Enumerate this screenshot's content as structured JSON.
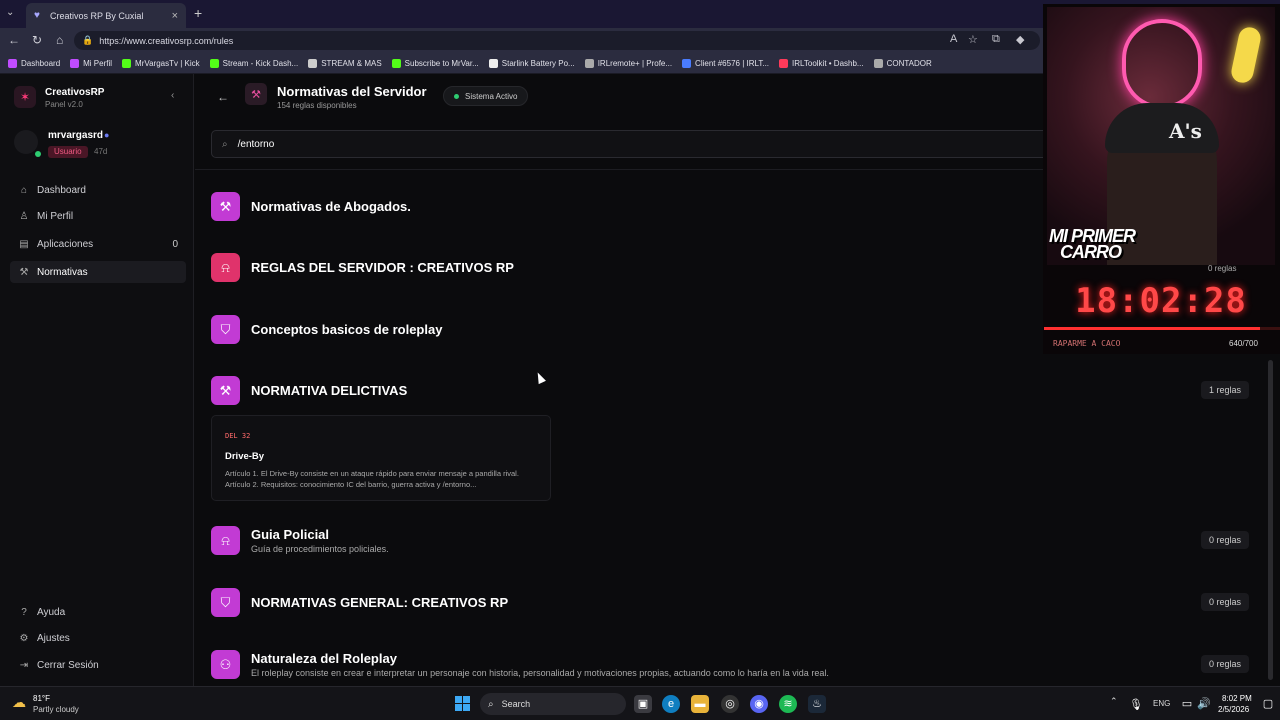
{
  "browser": {
    "tab_title": "Creativos RP By Cuxial",
    "url": "https://www.creativosrp.com/rules",
    "bookmarks": [
      {
        "label": "Dashboard",
        "color": "#c04cff"
      },
      {
        "label": "Mi Perfil",
        "color": "#c04cff"
      },
      {
        "label": "MrVargasTv | Kick",
        "color": "#53fc18"
      },
      {
        "label": "Stream - Kick Dash...",
        "color": "#53fc18"
      },
      {
        "label": "STREAM & MAS",
        "color": "#cccccc"
      },
      {
        "label": "Subscribe to MrVar...",
        "color": "#53fc18"
      },
      {
        "label": "Starlink Battery Po...",
        "color": "#eeeeee"
      },
      {
        "label": "IRLremote+ | Profe...",
        "color": "#aaaaaa"
      },
      {
        "label": "Client #6576 | IRLT...",
        "color": "#4a7cff"
      },
      {
        "label": "IRLToolkit • Dashb...",
        "color": "#ff3a5a"
      },
      {
        "label": "CONTADOR",
        "color": "#aaaaaa"
      }
    ]
  },
  "sidebar": {
    "brand_name": "CreativosRP",
    "brand_sub": "Panel v2.0",
    "username": "mrvargasrd",
    "role": "Usuario",
    "age": "47d",
    "items": [
      {
        "label": "Dashboard",
        "icon": "home-icon",
        "count": ""
      },
      {
        "label": "Mi Perfil",
        "icon": "user-icon",
        "count": ""
      },
      {
        "label": "Aplicaciones",
        "icon": "document-icon",
        "count": "0"
      },
      {
        "label": "Normativas",
        "icon": "gavel-icon",
        "count": ""
      }
    ],
    "bottom_items": [
      {
        "label": "Ayuda",
        "icon": "help-icon"
      },
      {
        "label": "Ajustes",
        "icon": "gear-icon"
      },
      {
        "label": "Cerrar Sesión",
        "icon": "logout-icon"
      }
    ]
  },
  "header": {
    "title": "Normativas del Servidor",
    "subtitle": "154 reglas disponibles",
    "status": "Sistema Activo"
  },
  "search": {
    "value": "/entorno"
  },
  "categories": [
    {
      "title": "Normativas de Abogados.",
      "desc": "",
      "count": "",
      "icon": "gavel-icon",
      "color": "#c23bd4"
    },
    {
      "title": "REGLAS DEL SERVIDOR : CREATIVOS RP",
      "desc": "",
      "count": "",
      "icon": "siren-icon",
      "color": "#e0336b"
    },
    {
      "title": "Conceptos basicos de roleplay",
      "desc": "",
      "count": "",
      "icon": "shield-icon",
      "color": "#c23bd4"
    },
    {
      "title": "NORMATIVA DELICTIVAS",
      "desc": "",
      "count": "1 reglas",
      "icon": "gavel-icon",
      "color": "#c23bd4"
    },
    {
      "title": "Guia Policial",
      "desc": "Guía de procedimientos policiales.",
      "count": "0 reglas",
      "icon": "siren-icon",
      "color": "#c23bd4"
    },
    {
      "title": "NORMATIVAS GENERAL: CREATIVOS RP",
      "desc": "",
      "count": "0 reglas",
      "icon": "shield-icon",
      "color": "#c23bd4"
    },
    {
      "title": "Naturaleza del Roleplay",
      "desc": "El roleplay consiste en crear e interpretar un personaje con historia, personalidad y motivaciones propias, actuando como lo haría en la vida real.",
      "count": "0 reglas",
      "icon": "users-icon",
      "color": "#c23bd4"
    }
  ],
  "rule": {
    "code": "DEL 32",
    "name": "Drive-By",
    "text": "Artículo 1. El Drive-By consiste en un ataque rápido para enviar mensaje a pandilla rival. Artículo 2. Requisitos: conocimiento IC del barrio, guerra activa y /entorno..."
  },
  "overlay": {
    "line1": "MI PRIMER",
    "line2": "CARRO",
    "reg_count": "0 reglas",
    "timer": "18:02:28",
    "goal_label": "RAPARME A CACO",
    "goal_count": "640/700",
    "goal_progress": 0.914
  },
  "taskbar": {
    "temp": "81°F",
    "weather": "Partly cloudy",
    "search": "Search",
    "lang": "ENG",
    "time": "8:02 PM",
    "date": "2/5/2026"
  }
}
